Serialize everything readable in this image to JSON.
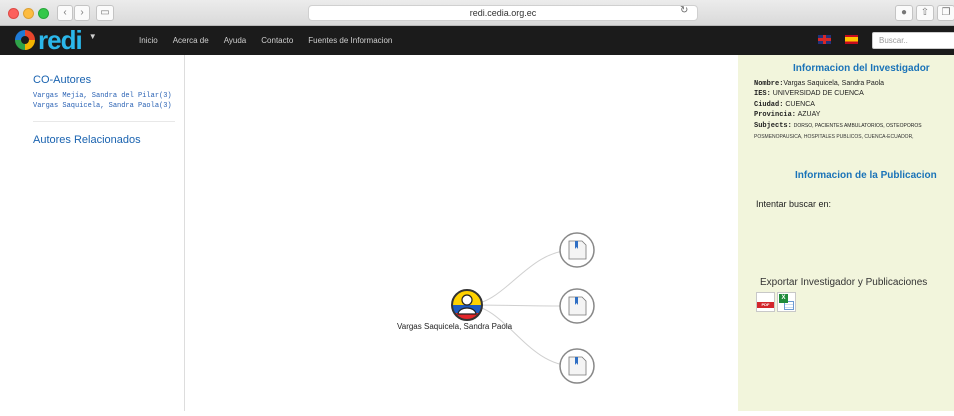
{
  "browser": {
    "url": "redi.cedia.org.ec"
  },
  "site": {
    "logo_text": "redi",
    "nav": [
      "Inicio",
      "Acerca de",
      "Ayuda",
      "Contacto",
      "Fuentes de Informacion"
    ],
    "search_placeholder": "Buscar.."
  },
  "sidebar": {
    "coautores_title": "CO-Autores",
    "coautores": [
      "Vargas Mejía, Sandra del Pilar(3)",
      "Vargas Saquicela, Sandra Paola(3)"
    ],
    "relacionados_title": "Autores Relacionados"
  },
  "graph": {
    "center_label": "Vargas Saquicela, Sandra Paola",
    "publication_nodes": 3
  },
  "investigator": {
    "title": "Informacion del Investigador",
    "nombre_label": "Nombre:",
    "nombre": "Vargas Saquicela, Sandra Paola",
    "ies_label": "IES:",
    "ies": "UNIVERSIDAD DE CUENCA",
    "ciudad_label": "Ciudad:",
    "ciudad": "CUENCA",
    "provincia_label": "Provincia:",
    "provincia": "AZUAY",
    "subjects_label": "Subjects:",
    "subjects_line1": "DORSO,  PACIENTES  AMBULATORIOS,  OSTEOPOROS",
    "subjects_line2": "POSMENOPAUSICA, HOSPITALES PUBLICOS, CUENCA-ECUADOR,"
  },
  "publication": {
    "title": "Informacion de la Publicacion",
    "intent": "Intentar buscar en:",
    "export": "Exportar Investigador y Publicaciones",
    "pdf_badge": "PDF"
  },
  "colors": {
    "nav_bg": "#1b1b1b",
    "logo": "#2bb7ea",
    "link": "#1a63b0",
    "panel_bg": "#f2f5dc"
  }
}
